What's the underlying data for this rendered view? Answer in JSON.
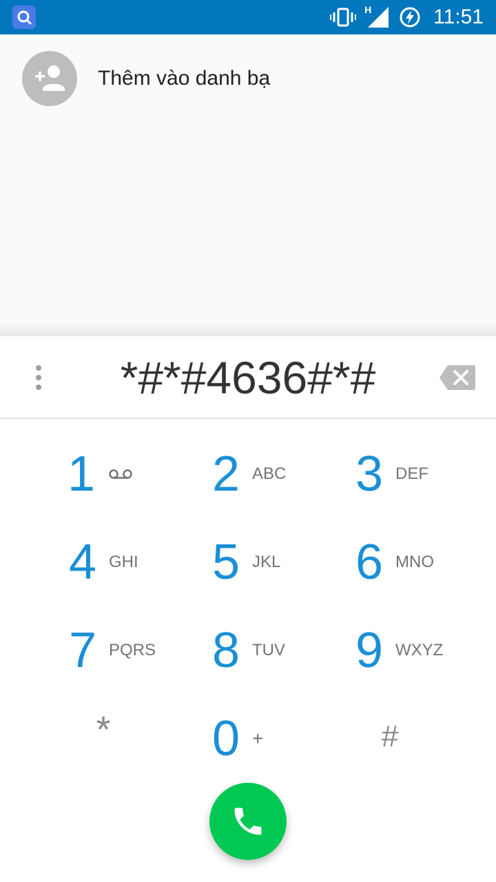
{
  "status_bar": {
    "time": "11:51",
    "network_type": "H",
    "icons": [
      "search-app-icon",
      "vibrate-icon",
      "signal-icon",
      "battery-charging-icon"
    ]
  },
  "suggestion": {
    "add_contact_label": "Thêm vào danh bạ",
    "icon": "add-person-icon"
  },
  "dialpad": {
    "entered_digits": "*#*#4636#*#",
    "keys": [
      {
        "num": "1",
        "letters": "",
        "icon": "voicemail-icon"
      },
      {
        "num": "2",
        "letters": "ABC"
      },
      {
        "num": "3",
        "letters": "DEF"
      },
      {
        "num": "4",
        "letters": "GHI"
      },
      {
        "num": "5",
        "letters": "JKL"
      },
      {
        "num": "6",
        "letters": "MNO"
      },
      {
        "num": "7",
        "letters": "PQRS"
      },
      {
        "num": "8",
        "letters": "TUV"
      },
      {
        "num": "9",
        "letters": "WXYZ"
      },
      {
        "num": "*",
        "letters": ""
      },
      {
        "num": "0",
        "letters": "+"
      },
      {
        "num": "#",
        "letters": ""
      }
    ]
  },
  "colors": {
    "status_bar": "#0277bd",
    "digit_blue": "#1a8fd6",
    "call_green": "#00c853",
    "avatar_grey": "#bdbdbd"
  }
}
